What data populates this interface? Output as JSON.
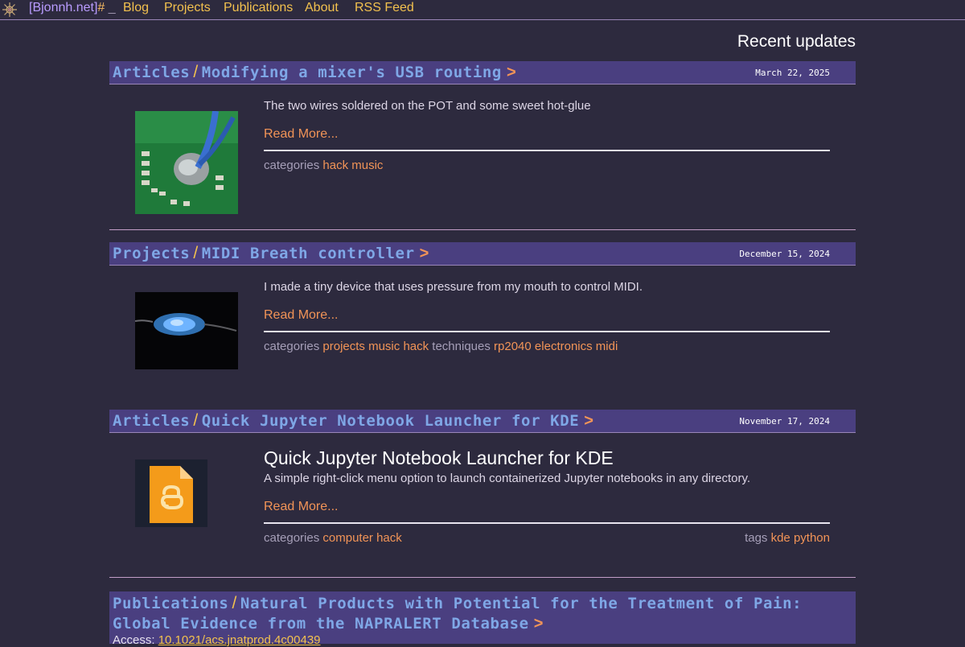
{
  "site": {
    "brand_open": "[",
    "brand_name": "Bjonnh.net",
    "brand_close": "]",
    "brand_hash": "#",
    "brand_cursor": "_"
  },
  "nav": {
    "items": [
      {
        "label": "Blog"
      },
      {
        "label": "Projects"
      },
      {
        "label": "Publications"
      },
      {
        "label": "About"
      },
      {
        "label": "RSS Feed"
      }
    ]
  },
  "main": {
    "heading": "Recent updates",
    "separator": "/",
    "arrow": ">",
    "read_more": "Read More...",
    "categories_label": "categories",
    "techniques_label": "techniques",
    "tags_label": "tags",
    "posts": [
      {
        "section": "Articles",
        "title": "Modifying a mixer's USB routing",
        "date": "March 22, 2025",
        "excerpt": "The two wires soldered on the POT and some sweet hot-glue",
        "categories": [
          "hack",
          "music"
        ]
      },
      {
        "section": "Projects",
        "title": "MIDI Breath controller",
        "date": "December 15, 2024",
        "excerpt": "I made a tiny device that uses pressure from my mouth to control MIDI.",
        "categories": [
          "projects",
          "music",
          "hack"
        ],
        "techniques": [
          "rp2040",
          "electronics",
          "midi"
        ]
      },
      {
        "section": "Articles",
        "title": "Quick Jupyter Notebook Launcher for KDE",
        "date": "November 17, 2024",
        "post_title": "Quick Jupyter Notebook Launcher for KDE",
        "excerpt": "A simple right-click menu option to launch containerized Jupyter notebooks in any directory.",
        "categories": [
          "computer",
          "hack"
        ],
        "tags": [
          "kde",
          "python"
        ]
      }
    ],
    "publication": {
      "section": "Publications",
      "title_line1": "Natural Products with Potential for the Treatment of Pain:",
      "title_line2": "Global Evidence from the NAPRALERT Database",
      "access_label": "Access:",
      "doi": "10.1021/acs.jnatprod.4c00439"
    }
  },
  "colors": {
    "background": "#2d2a3e",
    "header_band": "#4a3f80",
    "link_orange": "#f29457",
    "nav_yellow": "#f2c14e",
    "title_blue": "#7fa7e6"
  }
}
